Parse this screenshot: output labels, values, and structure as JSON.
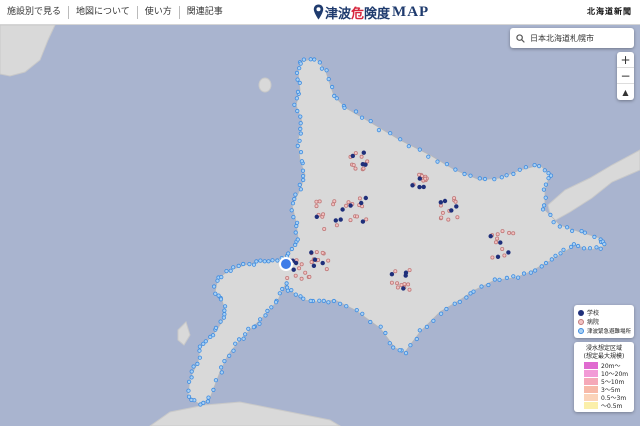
{
  "nav": {
    "items": [
      {
        "label": "施設別で見る"
      },
      {
        "label": "地図について"
      },
      {
        "label": "使い方"
      },
      {
        "label": "関連記事"
      }
    ]
  },
  "logo": {
    "part1": "津波",
    "part2": "危",
    "part3": "険度",
    "en": "MAP"
  },
  "brand": "北海道新聞",
  "search": {
    "value": "日本北海道札幌市"
  },
  "zoom": {
    "in": "+",
    "out": "−",
    "compass": "▲"
  },
  "legend": {
    "items": [
      {
        "label": "学校",
        "color": "#1f2f7a"
      },
      {
        "label": "病院",
        "color": "#f3c3c3"
      },
      {
        "label": "津波緊急避難場所",
        "color": "#6eaee8"
      }
    ]
  },
  "inundation": {
    "title1": "浸水想定区域",
    "title2": "(想定最大規模)",
    "levels": [
      {
        "label": "20m〜",
        "color": "#e06bd0"
      },
      {
        "label": "10〜20m",
        "color": "#f29ad6"
      },
      {
        "label": "5〜10m",
        "color": "#f5a8b8"
      },
      {
        "label": "3〜5m",
        "color": "#f7b9a8"
      },
      {
        "label": "0.5〜3m",
        "color": "#fbd3b9"
      },
      {
        "label": "〜0.5m",
        "color": "#fbefaa"
      }
    ]
  },
  "colors": {
    "sea": "#a9b4cf",
    "land": "#d9d9d9",
    "school": "#1f2f7a",
    "hospital": "#e9b0a0",
    "shelter": "#5aa0e8"
  }
}
